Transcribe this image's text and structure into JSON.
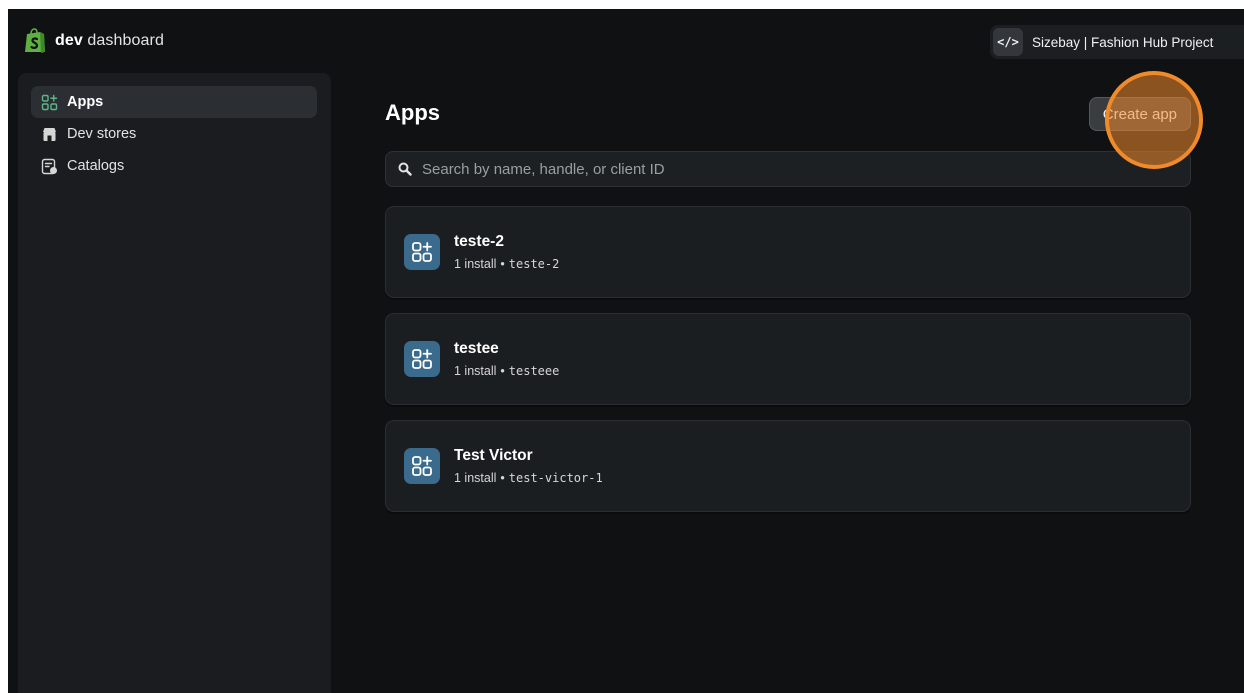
{
  "brand": {
    "bold": "dev",
    "rest": " dashboard"
  },
  "org": {
    "icon": "</>",
    "name": "Sizebay | Fashion Hub Project"
  },
  "sidebar": {
    "items": [
      {
        "label": "Apps",
        "icon": "apps-icon",
        "active": true
      },
      {
        "label": "Dev stores",
        "icon": "store-icon",
        "active": false
      },
      {
        "label": "Catalogs",
        "icon": "catalog-icon",
        "active": false
      }
    ]
  },
  "main": {
    "title": "Apps",
    "create_label": "Create app",
    "search": {
      "placeholder": "Search by name, handle, or client ID",
      "value": ""
    },
    "apps": [
      {
        "name": "teste-2",
        "installs": "1 install",
        "separator": "•",
        "handle": "teste-2"
      },
      {
        "name": "testee",
        "installs": "1 install",
        "separator": "•",
        "handle": "testeee"
      },
      {
        "name": "Test Victor",
        "installs": "1 install",
        "separator": "•",
        "handle": "test-victor-1"
      }
    ]
  },
  "colors": {
    "accent_ring": "#f08a2b",
    "app_icon_bg": "#3b6b8c",
    "brand_green": "#5fb043"
  }
}
